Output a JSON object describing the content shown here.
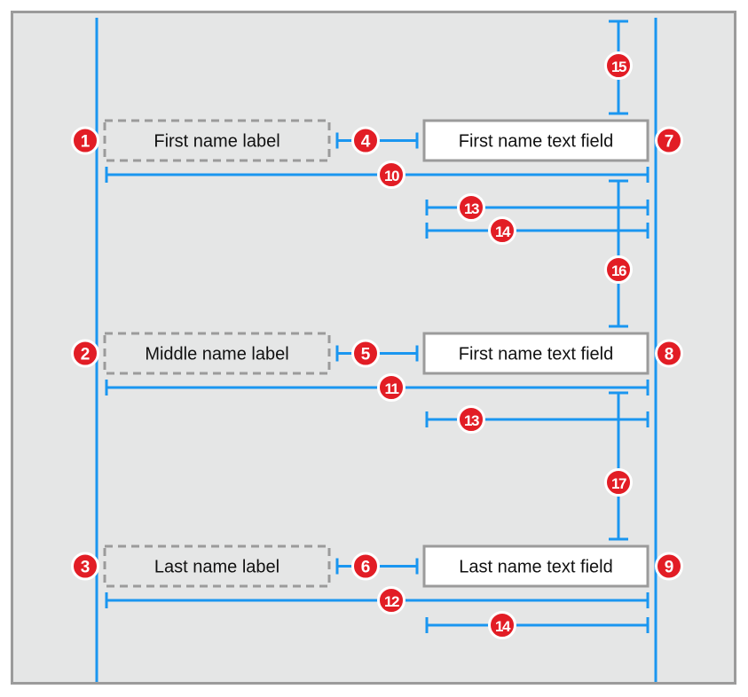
{
  "colors": {
    "background": "#e5e6e6",
    "frame": "#9b9b9b",
    "guide": "#1a96f0",
    "badge": "#e21d25",
    "badge_text": "#ffffff",
    "field_fill": "#ffffff",
    "text": "#111111"
  },
  "rows": [
    {
      "label": "First name label",
      "field": "First name text field",
      "label_badge": "1",
      "spacing_badge": "4",
      "field_badge": "7",
      "width_badge": "10"
    },
    {
      "label": "Middle name label",
      "field": "First name text field",
      "label_badge": "2",
      "spacing_badge": "5",
      "field_badge": "8",
      "width_badge": "11"
    },
    {
      "label": "Last name label",
      "field": "Last name text field",
      "label_badge": "3",
      "spacing_badge": "6",
      "field_badge": "9",
      "width_badge": "12"
    }
  ],
  "field_width_constraints": [
    {
      "badge": "13",
      "row_gap": 0,
      "slot": 0
    },
    {
      "badge": "14",
      "row_gap": 0,
      "slot": 1
    },
    {
      "badge": "13",
      "row_gap": 1,
      "slot": 0
    },
    {
      "badge": "14",
      "row_gap": 2,
      "slot": 0
    }
  ],
  "vertical_spacing_constraints": [
    {
      "badge": "15",
      "between": "top-guide to row 1"
    },
    {
      "badge": "16",
      "between": "row 1 to row 2"
    },
    {
      "badge": "17",
      "between": "row 2 to row 3"
    }
  ]
}
